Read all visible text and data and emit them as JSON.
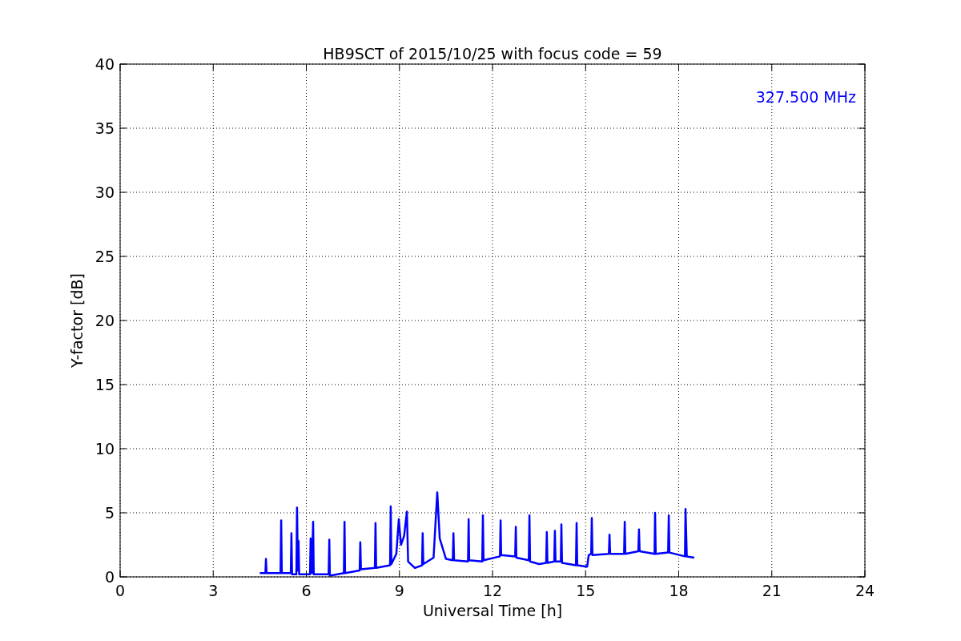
{
  "chart_data": {
    "type": "line",
    "title": "HB9SCT of 2015/10/25 with focus code = 59",
    "xlabel": "Universal Time [h]",
    "ylabel": "Y-factor [dB]",
    "xlim": [
      0,
      24
    ],
    "ylim": [
      0,
      40
    ],
    "grid": true,
    "xticks": [
      0,
      3,
      6,
      9,
      12,
      15,
      18,
      21,
      24
    ],
    "yticks": [
      0,
      5,
      10,
      15,
      20,
      25,
      30,
      35,
      40
    ],
    "x": [
      4.5,
      4.68,
      4.7,
      4.72,
      5.17,
      5.19,
      5.21,
      5.5,
      5.52,
      5.54,
      5.68,
      5.7,
      5.73,
      5.75,
      5.77,
      6.12,
      6.14,
      6.18,
      6.22,
      6.24,
      6.72,
      6.74,
      6.76,
      7.21,
      7.23,
      7.25,
      7.72,
      7.74,
      7.76,
      8.21,
      8.23,
      8.25,
      8.7,
      8.72,
      8.74,
      8.9,
      8.98,
      9.05,
      9.15,
      9.24,
      9.28,
      9.5,
      9.73,
      9.75,
      9.77,
      10.1,
      10.22,
      10.3,
      10.5,
      10.72,
      10.74,
      10.76,
      11.21,
      11.23,
      11.25,
      11.67,
      11.69,
      11.71,
      12.24,
      12.26,
      12.28,
      12.73,
      12.75,
      12.77,
      13.17,
      13.19,
      13.21,
      13.5,
      13.73,
      13.75,
      13.77,
      13.99,
      14.01,
      14.03,
      14.2,
      14.22,
      14.24,
      14.69,
      14.71,
      14.73,
      15.05,
      15.1,
      15.18,
      15.2,
      15.22,
      15.75,
      15.77,
      15.79,
      16.24,
      16.26,
      16.28,
      16.7,
      16.72,
      16.74,
      17.22,
      17.24,
      17.26,
      17.66,
      17.68,
      17.7,
      18.2,
      18.22,
      18.26,
      18.5
    ],
    "series": [
      {
        "name": "327.500 MHz",
        "color": "#0000ff",
        "values": [
          0.3,
          0.3,
          1.4,
          0.3,
          0.3,
          4.4,
          0.3,
          0.3,
          3.4,
          0.2,
          0.2,
          5.4,
          0.5,
          2.8,
          0.2,
          0.2,
          3.0,
          0.3,
          4.3,
          0.2,
          0.2,
          2.9,
          0.1,
          0.3,
          4.3,
          0.3,
          0.5,
          2.7,
          0.6,
          0.7,
          4.2,
          0.7,
          0.9,
          5.5,
          1.0,
          1.8,
          4.5,
          2.5,
          3.2,
          5.1,
          1.2,
          0.7,
          0.9,
          3.4,
          1.0,
          1.5,
          6.6,
          3.0,
          1.4,
          1.3,
          3.4,
          1.3,
          1.2,
          4.5,
          1.3,
          1.2,
          4.8,
          1.3,
          1.6,
          4.4,
          1.7,
          1.6,
          3.9,
          1.5,
          1.3,
          4.8,
          1.2,
          1.0,
          1.1,
          3.5,
          1.1,
          1.2,
          3.6,
          1.2,
          1.2,
          4.1,
          1.1,
          0.9,
          4.2,
          0.9,
          0.8,
          1.7,
          1.8,
          4.6,
          1.7,
          1.8,
          3.3,
          1.8,
          1.8,
          4.3,
          1.8,
          2.0,
          3.7,
          2.0,
          1.8,
          5.0,
          1.8,
          1.9,
          4.8,
          1.9,
          1.6,
          5.3,
          1.6,
          1.5
        ]
      }
    ]
  }
}
